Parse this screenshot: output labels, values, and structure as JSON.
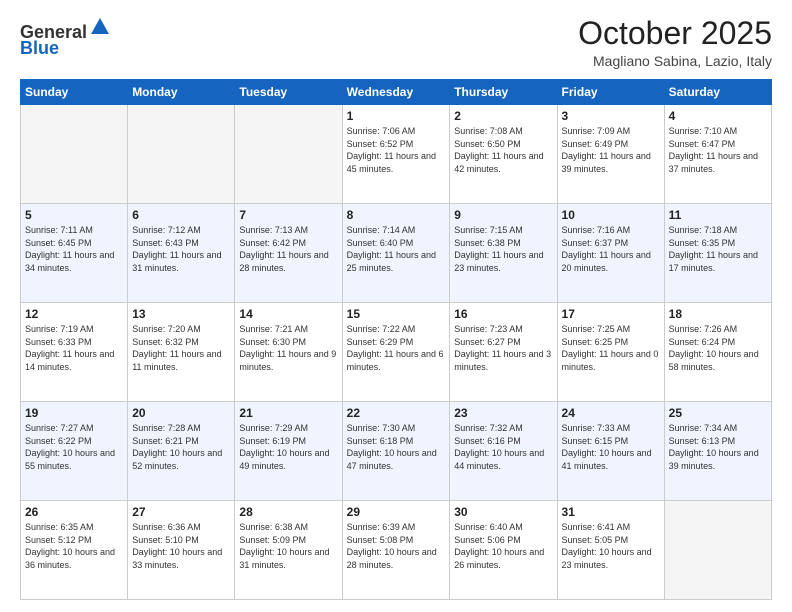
{
  "header": {
    "logo_general": "General",
    "logo_blue": "Blue",
    "month_title": "October 2025",
    "location": "Magliano Sabina, Lazio, Italy"
  },
  "days_of_week": [
    "Sunday",
    "Monday",
    "Tuesday",
    "Wednesday",
    "Thursday",
    "Friday",
    "Saturday"
  ],
  "weeks": [
    [
      {
        "day": "",
        "info": ""
      },
      {
        "day": "",
        "info": ""
      },
      {
        "day": "",
        "info": ""
      },
      {
        "day": "1",
        "info": "Sunrise: 7:06 AM\nSunset: 6:52 PM\nDaylight: 11 hours and 45 minutes."
      },
      {
        "day": "2",
        "info": "Sunrise: 7:08 AM\nSunset: 6:50 PM\nDaylight: 11 hours and 42 minutes."
      },
      {
        "day": "3",
        "info": "Sunrise: 7:09 AM\nSunset: 6:49 PM\nDaylight: 11 hours and 39 minutes."
      },
      {
        "day": "4",
        "info": "Sunrise: 7:10 AM\nSunset: 6:47 PM\nDaylight: 11 hours and 37 minutes."
      }
    ],
    [
      {
        "day": "5",
        "info": "Sunrise: 7:11 AM\nSunset: 6:45 PM\nDaylight: 11 hours and 34 minutes."
      },
      {
        "day": "6",
        "info": "Sunrise: 7:12 AM\nSunset: 6:43 PM\nDaylight: 11 hours and 31 minutes."
      },
      {
        "day": "7",
        "info": "Sunrise: 7:13 AM\nSunset: 6:42 PM\nDaylight: 11 hours and 28 minutes."
      },
      {
        "day": "8",
        "info": "Sunrise: 7:14 AM\nSunset: 6:40 PM\nDaylight: 11 hours and 25 minutes."
      },
      {
        "day": "9",
        "info": "Sunrise: 7:15 AM\nSunset: 6:38 PM\nDaylight: 11 hours and 23 minutes."
      },
      {
        "day": "10",
        "info": "Sunrise: 7:16 AM\nSunset: 6:37 PM\nDaylight: 11 hours and 20 minutes."
      },
      {
        "day": "11",
        "info": "Sunrise: 7:18 AM\nSunset: 6:35 PM\nDaylight: 11 hours and 17 minutes."
      }
    ],
    [
      {
        "day": "12",
        "info": "Sunrise: 7:19 AM\nSunset: 6:33 PM\nDaylight: 11 hours and 14 minutes."
      },
      {
        "day": "13",
        "info": "Sunrise: 7:20 AM\nSunset: 6:32 PM\nDaylight: 11 hours and 11 minutes."
      },
      {
        "day": "14",
        "info": "Sunrise: 7:21 AM\nSunset: 6:30 PM\nDaylight: 11 hours and 9 minutes."
      },
      {
        "day": "15",
        "info": "Sunrise: 7:22 AM\nSunset: 6:29 PM\nDaylight: 11 hours and 6 minutes."
      },
      {
        "day": "16",
        "info": "Sunrise: 7:23 AM\nSunset: 6:27 PM\nDaylight: 11 hours and 3 minutes."
      },
      {
        "day": "17",
        "info": "Sunrise: 7:25 AM\nSunset: 6:25 PM\nDaylight: 11 hours and 0 minutes."
      },
      {
        "day": "18",
        "info": "Sunrise: 7:26 AM\nSunset: 6:24 PM\nDaylight: 10 hours and 58 minutes."
      }
    ],
    [
      {
        "day": "19",
        "info": "Sunrise: 7:27 AM\nSunset: 6:22 PM\nDaylight: 10 hours and 55 minutes."
      },
      {
        "day": "20",
        "info": "Sunrise: 7:28 AM\nSunset: 6:21 PM\nDaylight: 10 hours and 52 minutes."
      },
      {
        "day": "21",
        "info": "Sunrise: 7:29 AM\nSunset: 6:19 PM\nDaylight: 10 hours and 49 minutes."
      },
      {
        "day": "22",
        "info": "Sunrise: 7:30 AM\nSunset: 6:18 PM\nDaylight: 10 hours and 47 minutes."
      },
      {
        "day": "23",
        "info": "Sunrise: 7:32 AM\nSunset: 6:16 PM\nDaylight: 10 hours and 44 minutes."
      },
      {
        "day": "24",
        "info": "Sunrise: 7:33 AM\nSunset: 6:15 PM\nDaylight: 10 hours and 41 minutes."
      },
      {
        "day": "25",
        "info": "Sunrise: 7:34 AM\nSunset: 6:13 PM\nDaylight: 10 hours and 39 minutes."
      }
    ],
    [
      {
        "day": "26",
        "info": "Sunrise: 6:35 AM\nSunset: 5:12 PM\nDaylight: 10 hours and 36 minutes."
      },
      {
        "day": "27",
        "info": "Sunrise: 6:36 AM\nSunset: 5:10 PM\nDaylight: 10 hours and 33 minutes."
      },
      {
        "day": "28",
        "info": "Sunrise: 6:38 AM\nSunset: 5:09 PM\nDaylight: 10 hours and 31 minutes."
      },
      {
        "day": "29",
        "info": "Sunrise: 6:39 AM\nSunset: 5:08 PM\nDaylight: 10 hours and 28 minutes."
      },
      {
        "day": "30",
        "info": "Sunrise: 6:40 AM\nSunset: 5:06 PM\nDaylight: 10 hours and 26 minutes."
      },
      {
        "day": "31",
        "info": "Sunrise: 6:41 AM\nSunset: 5:05 PM\nDaylight: 10 hours and 23 minutes."
      },
      {
        "day": "",
        "info": ""
      }
    ]
  ]
}
